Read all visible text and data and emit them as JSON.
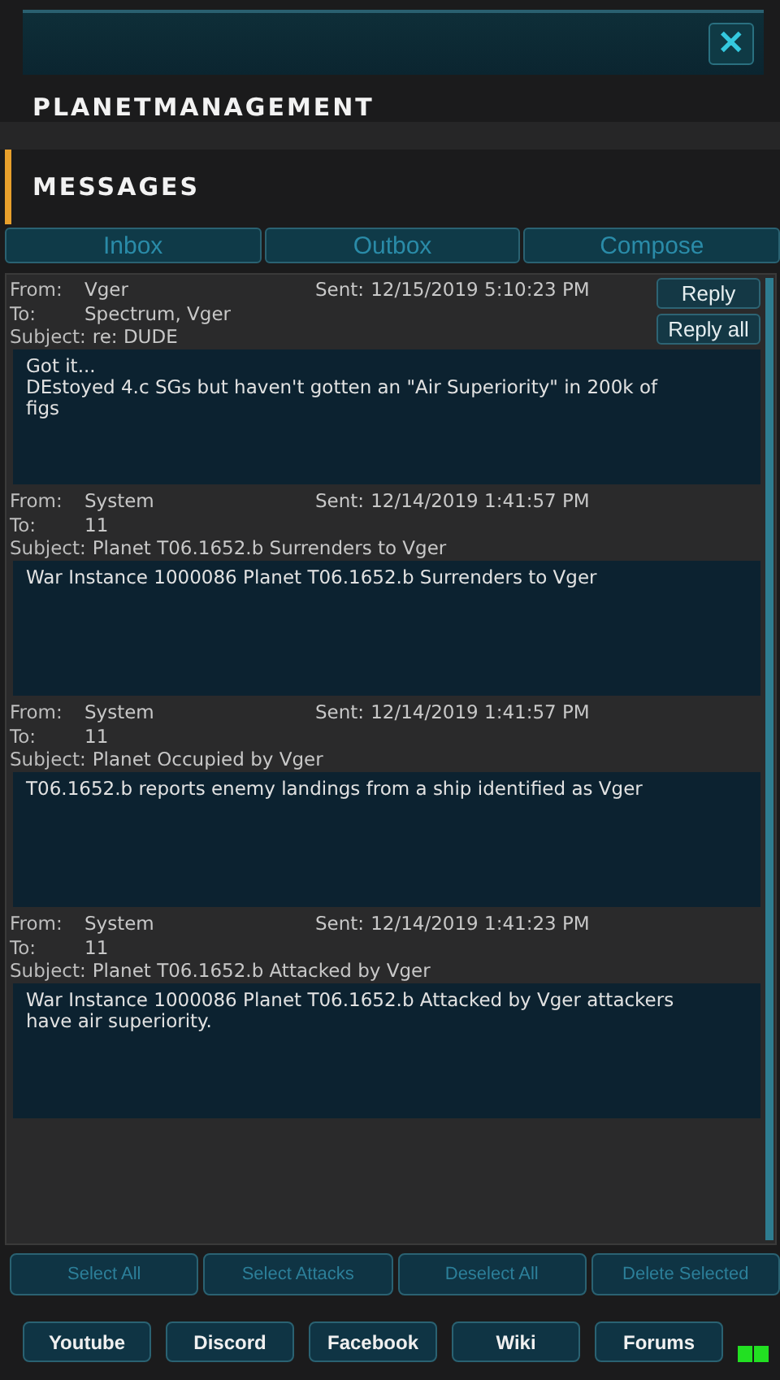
{
  "window": {
    "title": "PLANETMANAGEMENT",
    "close": "✕"
  },
  "section": {
    "title": "MESSAGES"
  },
  "tabs": [
    {
      "label": "Inbox"
    },
    {
      "label": "Outbox"
    },
    {
      "label": "Compose"
    }
  ],
  "messages": [
    {
      "from_label": "From:",
      "from": "Vger",
      "sent_label": "Sent:",
      "sent": "12/15/2019 5:10:23 PM",
      "to_label": "To:",
      "to": "Spectrum, Vger",
      "subject_label": "Subject:",
      "subject": "re: DUDE",
      "body": [
        "Got it...",
        "DEstoyed 4.c SGs but haven't gotten an \"Air Superiority\" in 200k of figs"
      ],
      "actions": [
        "Reply",
        "Reply all"
      ]
    },
    {
      "from_label": "From:",
      "from": "System",
      "sent_label": "Sent:",
      "sent": "12/14/2019 1:41:57 PM",
      "to_label": "To:",
      "to": "11",
      "subject_label": "Subject:",
      "subject": "Planet T06.1652.b Surrenders to Vger",
      "body": [
        "War Instance 1000086 Planet T06.1652.b Surrenders to Vger"
      ]
    },
    {
      "from_label": "From:",
      "from": "System",
      "sent_label": "Sent:",
      "sent": "12/14/2019 1:41:57 PM",
      "to_label": "To:",
      "to": "11",
      "subject_label": "Subject:",
      "subject": "Planet Occupied by Vger",
      "body": [
        "T06.1652.b reports enemy landings from a ship identified as Vger"
      ]
    },
    {
      "from_label": "From:",
      "from": "System",
      "sent_label": "Sent:",
      "sent": "12/14/2019 1:41:23 PM",
      "to_label": "To:",
      "to": "11",
      "subject_label": "Subject:",
      "subject": "Planet T06.1652.b Attacked by Vger",
      "body": [
        "War Instance 1000086 Planet T06.1652.b Attacked by Vger attackers have air superiority."
      ]
    }
  ],
  "bulk_actions": [
    "Select All",
    "Select Attacks",
    "Deselect All",
    "Delete Selected"
  ],
  "links": [
    "Youtube",
    "Discord",
    "Facebook",
    "Wiki",
    "Forums"
  ]
}
